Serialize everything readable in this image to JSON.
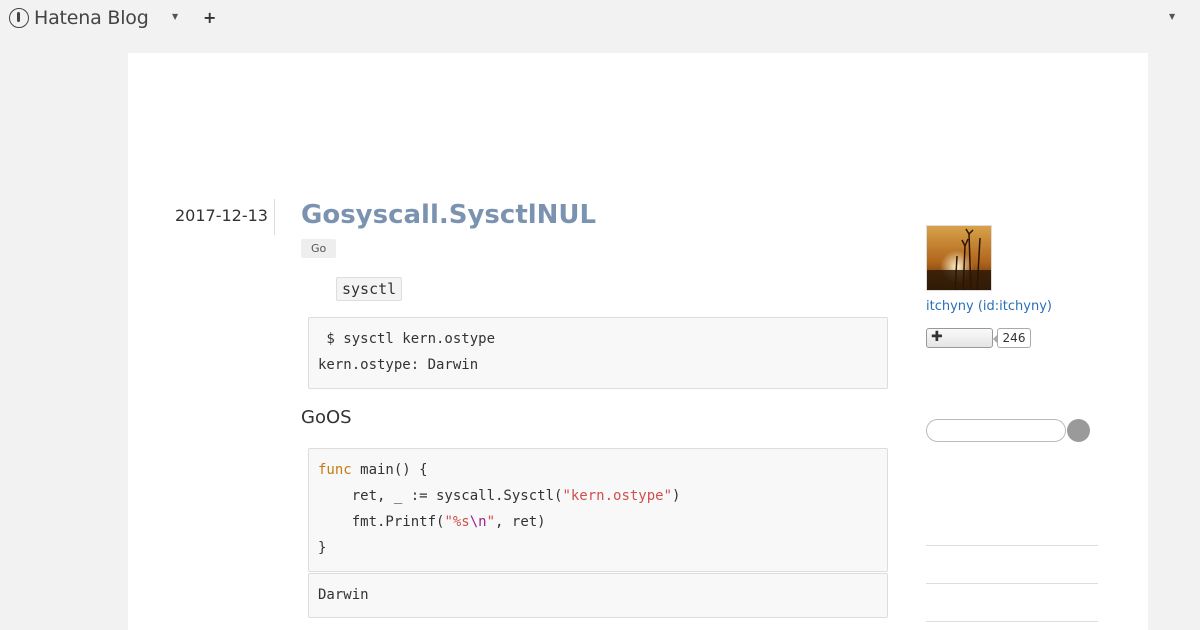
{
  "header": {
    "brand": "Hatena Blog",
    "icons": [
      "hatena-blog-logo-icon",
      "chevron-down-icon",
      "plus-icon",
      "chevron-down-icon"
    ]
  },
  "entry": {
    "date": "2017-12-13",
    "title": "Gosyscall.SysctlNUL",
    "category": "Go",
    "inline_code": "sysctl",
    "code1": [
      " $ sysctl kern.ostype",
      "kern.ostype: Darwin"
    ],
    "heading": "GoOS",
    "code2": {
      "func_kw": "func",
      "line1_rest": " main() {",
      "line2_pre": "    ret, _ := syscall.Sysctl(",
      "line2_str": "\"kern.ostype\"",
      "line2_post": ")",
      "line3_pre": "    fmt.Printf(",
      "line3_str_a": "\"%s",
      "line3_esc": "\\n",
      "line3_str_b": "\"",
      "line3_post": ", ret)",
      "line4": "}"
    },
    "output": "Darwin"
  },
  "sidebar": {
    "profile_name": "itchyny (id:itchyny)",
    "follow_label": "✚",
    "follow_count": "246"
  },
  "colors": {
    "title": "#7b93b0",
    "link": "#2a6fb5",
    "keyword": "#c57a12",
    "string": "#d14f4f",
    "escape": "#9b2393"
  }
}
